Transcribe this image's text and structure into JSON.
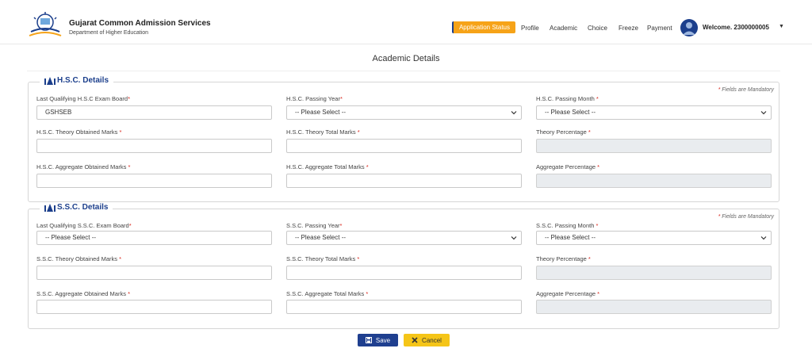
{
  "header": {
    "brand_title": "Gujarat Common Admission Services",
    "brand_subtitle": "Department of Higher Education",
    "nav": {
      "application_status": "Application Status",
      "profile": "Profile",
      "academic": "Academic",
      "choice": "Choice",
      "freeze": "Freeze",
      "payment": "Payment"
    },
    "welcome": "Welcome. 2300000005"
  },
  "page": {
    "title": "Academic Details"
  },
  "hsc": {
    "legend": "H.S.C. Details",
    "mandatory_note": "Fields are Mandatory",
    "exam_board": {
      "label": "Last Qualifying H.S.C Exam Board",
      "value": "GSHSEB"
    },
    "passing_year": {
      "label": "H.S.C. Passing Year",
      "value": "-- Please Select --"
    },
    "passing_month": {
      "label": "H.S.C. Passing Month ",
      "value": "-- Please Select --"
    },
    "theory_obtained": {
      "label": "H.S.C. Theory Obtained Marks ",
      "value": ""
    },
    "theory_total": {
      "label": "H.S.C. Theory Total Marks ",
      "value": ""
    },
    "theory_percentage": {
      "label": "Theory Percentage ",
      "value": ""
    },
    "aggregate_obtained": {
      "label": "H.S.C. Aggregate Obtained Marks ",
      "value": ""
    },
    "aggregate_total": {
      "label": "H.S.C. Aggregate Total Marks ",
      "value": ""
    },
    "aggregate_percentage": {
      "label": "Aggregate Percentage ",
      "value": ""
    }
  },
  "ssc": {
    "legend": "S.S.C. Details",
    "mandatory_note": "Fields are Mandatory",
    "exam_board": {
      "label": "Last Qualifying S.S.C. Exam Board",
      "value": "-- Please Select --"
    },
    "passing_year": {
      "label": "S.S.C. Passing Year",
      "value": "-- Please Select --"
    },
    "passing_month": {
      "label": "S.S.C. Passing Month ",
      "value": "-- Please Select --"
    },
    "theory_obtained": {
      "label": "S.S.C. Theory Obtained Marks ",
      "value": ""
    },
    "theory_total": {
      "label": "S.S.C. Theory Total Marks ",
      "value": ""
    },
    "theory_percentage": {
      "label": "Theory Percentage ",
      "value": ""
    },
    "aggregate_obtained": {
      "label": "S.S.C. Aggregate Obtained Marks ",
      "value": ""
    },
    "aggregate_total": {
      "label": "S.S.C. Aggregate Total Marks ",
      "value": ""
    },
    "aggregate_percentage": {
      "label": "Aggregate Percentage ",
      "value": ""
    }
  },
  "actions": {
    "save": "Save",
    "cancel": "Cancel"
  },
  "colors": {
    "primary": "#1c3f8c",
    "accent": "#f6a318",
    "cancel": "#f5c518",
    "required": "#d9261c"
  }
}
